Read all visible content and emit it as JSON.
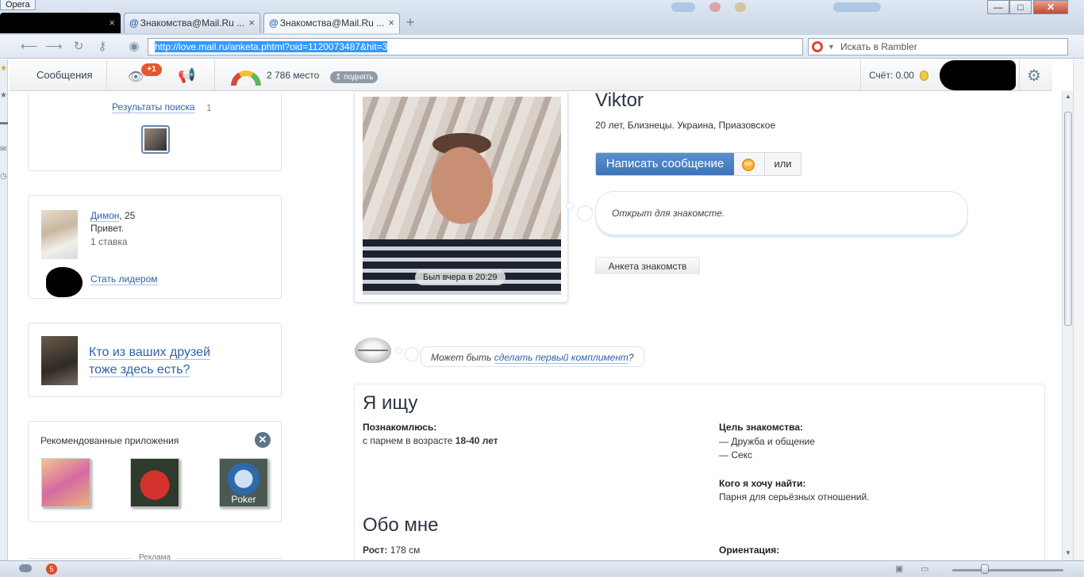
{
  "browser": {
    "app_badge": "Opera",
    "tabs": [
      {
        "label": "",
        "redacted": true
      },
      {
        "label": "Знакомства@Mail.Ru ..."
      },
      {
        "label": "Знакомства@Mail.Ru ...",
        "active": true
      }
    ],
    "tab_close_glyph": "×",
    "new_tab_glyph": "+",
    "window_buttons": [
      "—",
      "□",
      "✕"
    ],
    "url": "http://love.mail.ru/anketa.phtml?oid=1120073487&hit=3",
    "search_placeholder": "Искать в Rambler",
    "icons": [
      "back-icon",
      "forward-icon",
      "reload-icon",
      "key-icon",
      "globe-icon",
      "rambler-icon"
    ],
    "zoom_fraction": 0.29
  },
  "toolbar": {
    "messages": "Сообщения",
    "views_badge": "+1",
    "rank": "2 786 место",
    "raise": "↥ поднять",
    "account": "Счёт: 0.00",
    "icons": [
      "eye-icon",
      "megaphone-icon",
      "gauge-icon",
      "coin-icon",
      "gear-icon"
    ]
  },
  "sidebar": {
    "search_results": {
      "label": "Результаты поиска",
      "count": "1"
    },
    "leader": {
      "name": "Димон",
      "age": ", 25",
      "message": "Привет.",
      "bets": "1 ставка",
      "become_leader": "Стать лидером"
    },
    "friends": {
      "line1": "Кто из ваших друзей",
      "line2": "тоже здесь есть?"
    },
    "apps": {
      "title": "Рекомендованные приложения",
      "close": "✕",
      "items": [
        {
          "name": "app-girl"
        },
        {
          "name": "app-strawberry"
        },
        {
          "name": "app-poker",
          "caption": "Poker"
        }
      ]
    },
    "ad_label": "Реклама"
  },
  "profile": {
    "name": "Viktor",
    "meta": "20 лет, Близнецы. Украина, Приазовское",
    "last_seen": "Был вчера в 20:29",
    "write_message": "Написать сообщение",
    "vip": "VIP",
    "or": "или",
    "status": "Открыт для знакомсте.",
    "anketa_tab": "Анкета знакомств",
    "compliment_prefix": "Может быть ",
    "compliment_link": "сделать первый комплимент",
    "compliment_suffix": "?"
  },
  "seeking": {
    "title": "Я ищу",
    "meet_label": "Познакомлюсь:",
    "meet_value": "с парнем в возрасте ",
    "meet_age": "18-40 лет",
    "goal_label": "Цель знакомства:",
    "goals": [
      "— Дружба и общение",
      "— Секс"
    ],
    "whom_label": "Кого я хочу найти:",
    "whom_value": "Парня для серьёзных отношений."
  },
  "about": {
    "title": "Обо мне",
    "height_label": "Рост:",
    "height_value": " 178 см",
    "orientation_label": "Ориентация:"
  },
  "statusbar": {
    "badge": "5",
    "icons": [
      "cloud-icon",
      "unite-icon",
      "panel-icon",
      "view-icon",
      "zoom-slider"
    ]
  }
}
